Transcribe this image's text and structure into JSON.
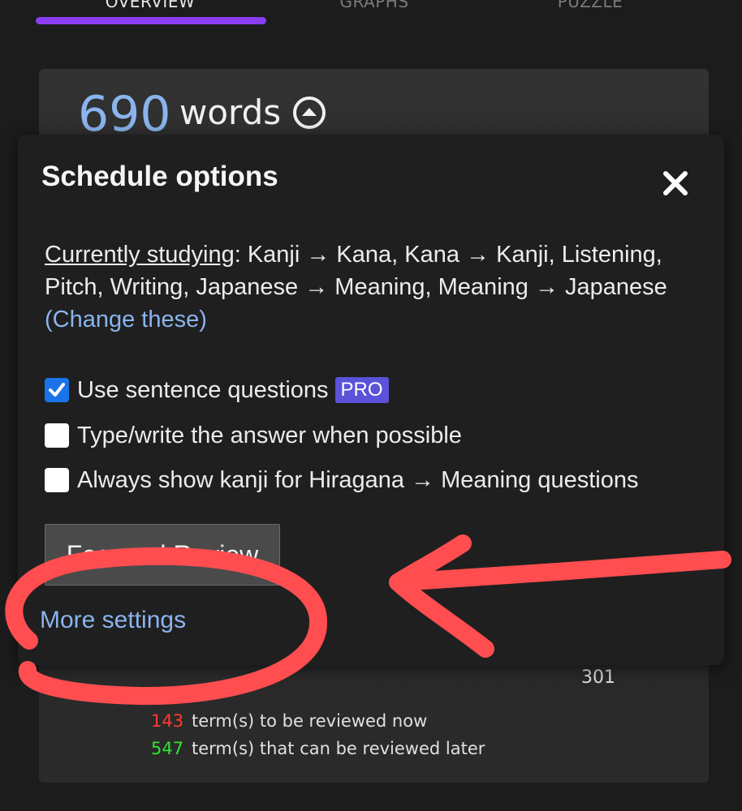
{
  "tabs": [
    {
      "label": "OVERVIEW",
      "active": true
    },
    {
      "label": "GRAPHS",
      "active": false
    },
    {
      "label": "PUZZLE",
      "active": false
    }
  ],
  "summary": {
    "count": "690",
    "unit": "words"
  },
  "modal": {
    "title": "Schedule options",
    "studying_label": "Currently studying",
    "studying_text": ": Kanji → Kana, Kana → Kanji, Listening, Pitch, Writing, Japanese → Meaning, Meaning → Japanese ",
    "change_link": "(Change these)",
    "options": [
      {
        "label": "Use sentence questions",
        "checked": true,
        "badge": "PRO"
      },
      {
        "label": "Type/write the answer when possible",
        "checked": false
      },
      {
        "label": "Always show kanji for Hiragana → Meaning questions",
        "checked": false
      }
    ],
    "focused_review_label": "Focused Review",
    "more_settings_label": "More settings"
  },
  "stats": {
    "value_301": "301",
    "due_now": {
      "count": "143",
      "text": "term(s) to be reviewed now"
    },
    "due_later": {
      "count": "547",
      "text": "term(s) that can be reviewed later"
    }
  },
  "colors": {
    "accent": "#8a3df3",
    "link": "#8ab4ee",
    "pro_badge": "#5a52d8",
    "due_now": "#ff3b30",
    "due_later": "#2ee62e",
    "annotation": "#ff4d50"
  }
}
